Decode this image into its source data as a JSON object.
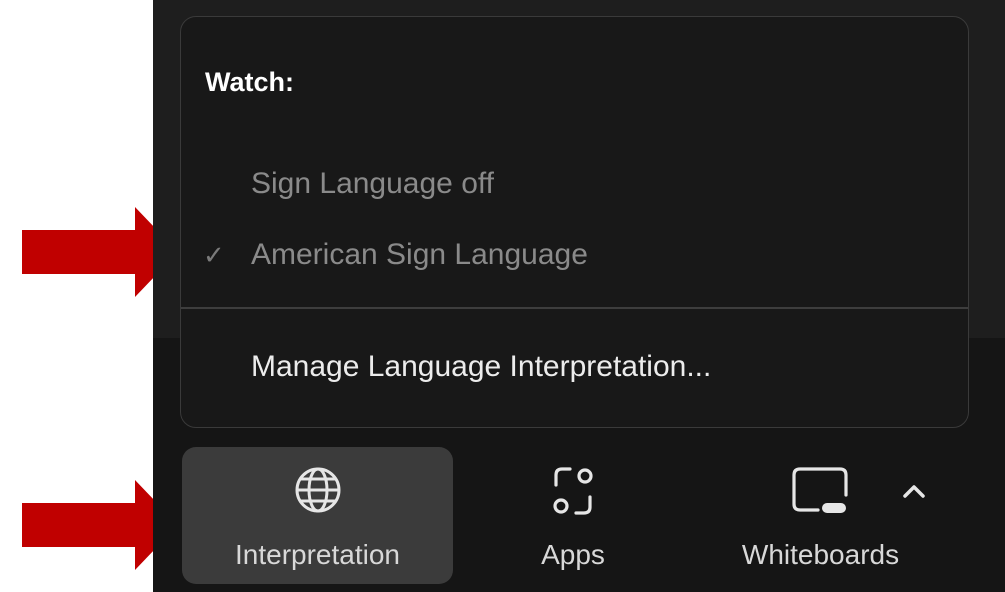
{
  "menu": {
    "heading": "Watch:",
    "items": [
      {
        "label": "Sign Language off",
        "checked": false
      },
      {
        "label": "American Sign Language",
        "checked": true
      }
    ],
    "check_glyph": "✓",
    "manage_label": "Manage Language Interpretation..."
  },
  "toolbar": {
    "buttons": [
      {
        "label": "Interpretation",
        "icon": "globe-icon",
        "active": true
      },
      {
        "label": "Apps",
        "icon": "apps-icon",
        "active": false
      },
      {
        "label": "Whiteboards",
        "icon": "whiteboard-icon",
        "active": false
      }
    ],
    "more_icon": "chevron-up-icon"
  },
  "annotations": {
    "arrow_color": "#c00000",
    "count": 2
  },
  "colors": {
    "screen_bg": "#1e1e1e",
    "menu_bg": "#181818",
    "toolbar_bg": "#151515",
    "active_button_bg": "#3b3b3b"
  }
}
